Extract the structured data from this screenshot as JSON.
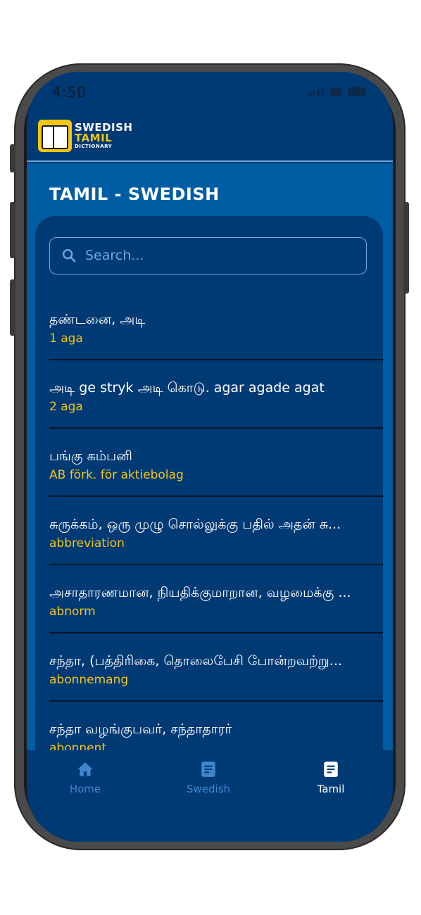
{
  "status_bar": {
    "time": "4:50"
  },
  "header": {
    "logo_line1": "SWEDISH",
    "logo_line2": "TAMIL",
    "logo_line3": "DICTIONARY"
  },
  "page": {
    "title": "TAMIL - SWEDISH"
  },
  "search": {
    "placeholder": "Search..."
  },
  "entries": [
    {
      "tamil": "தண்டனை, அடி",
      "swedish": "1 aga"
    },
    {
      "tamil": "அடி ge stryk அடி கொடு. agar agade agat",
      "swedish": "2 aga"
    },
    {
      "tamil": "பங்கு கம்பனி",
      "swedish": "AB förk. för aktiebolag"
    },
    {
      "tamil": "சுருக்கம், ஒரு முழு சொல்லுக்கு பதில் அதன் சு...",
      "swedish": "abbreviation"
    },
    {
      "tamil": "அசாதாரணமான, நியதிக்குமாறான, வழமைக்கு ...",
      "swedish": "abnorm"
    },
    {
      "tamil": "சந்தா, (பத்திரிகை, தொலைபேசி போன்றவற்று...",
      "swedish": "abonnemang"
    },
    {
      "tamil": "சந்தா வழங்குபவர், சந்தாதாரர்",
      "swedish": "abonnent"
    }
  ],
  "tabs": [
    {
      "label": "Home",
      "icon": "home-icon",
      "active": false
    },
    {
      "label": "Swedish",
      "icon": "document-icon",
      "active": false
    },
    {
      "label": "Tamil",
      "icon": "document-icon",
      "active": true
    }
  ],
  "colors": {
    "primary": "#003a75",
    "secondary": "#005da3",
    "accent": "#f3c515",
    "tab_inactive": "#3f86cf"
  }
}
